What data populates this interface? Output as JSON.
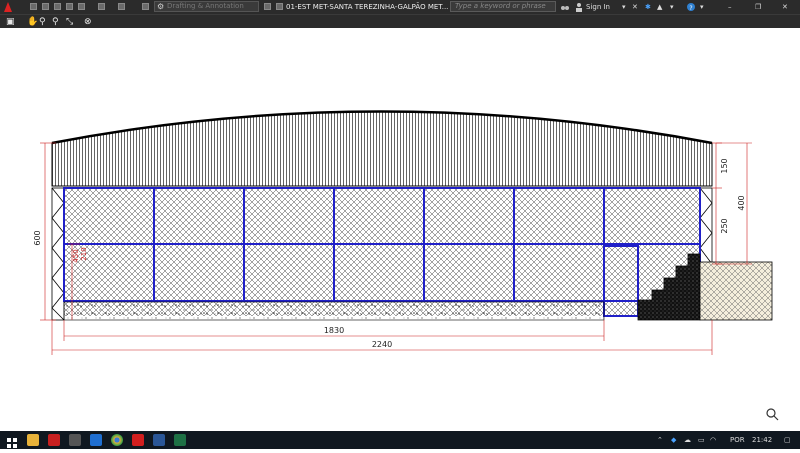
{
  "titlebar": {
    "workspace_label": "Drafting & Annotation",
    "document_title": "01-EST MET-SANTA TEREZINHA-GALPÃO MET...",
    "search_placeholder": "Type a keyword or phrase",
    "sign_in": "Sign In"
  },
  "drawing": {
    "dim_height_total": "600",
    "dim_roof_rise": "150",
    "dim_upper_total": "400",
    "dim_wall": "250",
    "dim_inner": "450",
    "dim_inner2": "210",
    "dim_span_inner": "1830",
    "dim_span_total": "2240"
  },
  "taskbar": {
    "lang": "POR",
    "time": "21:42"
  },
  "colors": {
    "titlebar_bg": "#2b2b2b",
    "taskbar_bg": "#101820",
    "frame_blue": "#2020c8",
    "dimension_red": "#cc2020"
  }
}
